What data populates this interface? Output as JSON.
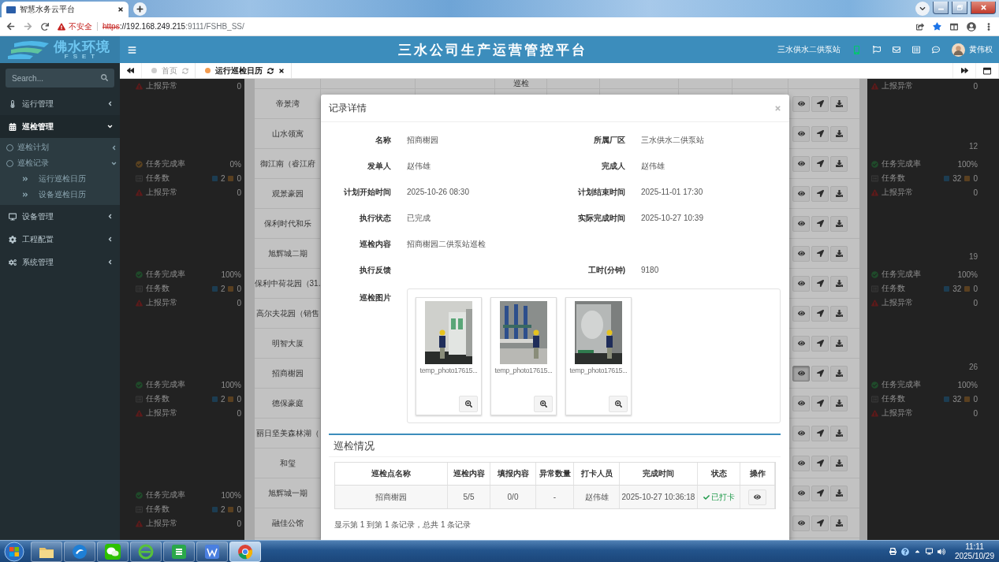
{
  "browser": {
    "tab_title": "智慧水务云平台",
    "warning": "不安全",
    "url": [
      {
        "kind": "scheme",
        "text": "https"
      },
      {
        "kind": "host",
        "text": "://192.168.249.215"
      },
      {
        "kind": "path",
        "text": ":9111/FSHB_SS/"
      }
    ]
  },
  "header": {
    "logo_name": "佛水环境",
    "logo_sub": "FSET",
    "title": "三水公司生产运营管控平台",
    "station": "三水供水二供泵站",
    "user": "黄伟权"
  },
  "sidebar": {
    "search_placeholder": "Search...",
    "items": [
      {
        "label": "运行管理",
        "selected": false,
        "expanded": false
      },
      {
        "label": "巡检管理",
        "selected": true,
        "expanded": true,
        "children": [
          {
            "label": "巡检计划",
            "expanded": false
          },
          {
            "label": "巡检记录",
            "expanded": true,
            "children": [
              {
                "label": "运行巡检日历"
              },
              {
                "label": "设备巡检日历"
              }
            ]
          }
        ]
      },
      {
        "label": "设备管理",
        "selected": false,
        "expanded": false
      },
      {
        "label": "工程配置",
        "selected": false,
        "expanded": false
      },
      {
        "label": "系统管理",
        "selected": false,
        "expanded": false
      }
    ]
  },
  "page_tabs": [
    {
      "label": "首页",
      "selected": false,
      "closable": false
    },
    {
      "label": "运行巡检日历",
      "selected": true,
      "closable": true
    }
  ],
  "calendar_left": {
    "top": [
      {
        "kind": "anomaly",
        "label": "上报异常",
        "value": "0"
      }
    ],
    "weeks": [
      {
        "stats": [
          {
            "kind": "rate",
            "label": "任务完成率",
            "value": "0%",
            "color": "#5a4220"
          },
          {
            "kind": "count",
            "label": "任务数",
            "done": "2",
            "pending": "0"
          },
          {
            "kind": "anomaly",
            "label": "上报异常",
            "value": "0"
          }
        ]
      },
      {
        "stats": [
          {
            "kind": "rate",
            "label": "任务完成率",
            "value": "100%",
            "color": "#1f4a2a"
          },
          {
            "kind": "count",
            "label": "任务数",
            "done": "2",
            "pending": "0"
          },
          {
            "kind": "anomaly",
            "label": "上报异常",
            "value": "0"
          }
        ]
      },
      {
        "stats": [
          {
            "kind": "rate",
            "label": "任务完成率",
            "value": "100%",
            "color": "#1f4a2a"
          },
          {
            "kind": "count",
            "label": "任务数",
            "done": "2",
            "pending": "0"
          },
          {
            "kind": "anomaly",
            "label": "上报异常",
            "value": "0"
          }
        ]
      },
      {
        "stats": [
          {
            "kind": "rate",
            "label": "任务完成率",
            "value": "100%",
            "color": "#1f4a2a"
          },
          {
            "kind": "count",
            "label": "任务数",
            "done": "2",
            "pending": "0"
          },
          {
            "kind": "anomaly",
            "label": "上报异常",
            "value": "0"
          }
        ]
      }
    ]
  },
  "calendar_right": {
    "top": [
      {
        "kind": "anomaly",
        "label": "上报异常",
        "value": "0"
      }
    ],
    "weeks": [
      {
        "day": "12",
        "stats": [
          {
            "kind": "rate",
            "label": "任务完成率",
            "value": "100%",
            "color": "#1f4a2a"
          },
          {
            "kind": "count",
            "label": "任务数",
            "done": "32",
            "pending": "0"
          },
          {
            "kind": "anomaly",
            "label": "上报异常",
            "value": "0"
          }
        ]
      },
      {
        "day": "19",
        "stats": [
          {
            "kind": "rate",
            "label": "任务完成率",
            "value": "100%",
            "color": "#1f4a2a"
          },
          {
            "kind": "count",
            "label": "任务数",
            "done": "32",
            "pending": "0"
          },
          {
            "kind": "anomaly",
            "label": "上报异常",
            "value": "0"
          }
        ]
      },
      {
        "day": "26",
        "stats": [
          {
            "kind": "rate",
            "label": "任务完成率",
            "value": "100%",
            "color": "#1f4a2a"
          },
          {
            "kind": "count",
            "label": "任务数",
            "done": "32",
            "pending": "0"
          },
          {
            "kind": "anomaly",
            "label": "上报异常",
            "value": "0"
          }
        ]
      }
    ]
  },
  "table": {
    "partial_row_text": "巡检",
    "rows": [
      {
        "name": "帝景湾",
        "selected": false
      },
      {
        "name": "山水领寓",
        "selected": false
      },
      {
        "name": "御江南（睿江府",
        "selected": false
      },
      {
        "name": "观景豪园",
        "selected": false
      },
      {
        "name": "保利时代和乐",
        "selected": false
      },
      {
        "name": "旭辉城二期",
        "selected": false
      },
      {
        "name": "保利中荷花园（31.",
        "selected": false
      },
      {
        "name": "高尔夫花园（销售",
        "selected": false
      },
      {
        "name": "明智大厦",
        "selected": false
      },
      {
        "name": "招商榭园",
        "selected": true
      },
      {
        "name": "德保豪庭",
        "selected": false
      },
      {
        "name": "丽日坚美森林湖（",
        "selected": false
      },
      {
        "name": "和玺",
        "selected": false
      },
      {
        "name": "旭辉城一期",
        "selected": false
      },
      {
        "name": "融佳公馆",
        "selected": false
      }
    ]
  },
  "modal": {
    "title": "记录详情",
    "rows": [
      {
        "fields": [
          {
            "label": "名称",
            "value": "招商榭园"
          },
          {
            "label": "所属厂区",
            "value": "三水供水二供泵站"
          }
        ]
      },
      {
        "fields": [
          {
            "label": "发单人",
            "value": "赵伟雄"
          },
          {
            "label": "完成人",
            "value": "赵伟雄"
          }
        ]
      },
      {
        "fields": [
          {
            "label": "计划开始时间",
            "value": "2025-10-26 08:30"
          },
          {
            "label": "计划结束时间",
            "value": "2025-11-01 17:30"
          }
        ]
      },
      {
        "fields": [
          {
            "label": "执行状态",
            "value": "已完成"
          },
          {
            "label": "实际完成时间",
            "value": "2025-10-27 10:39"
          }
        ]
      },
      {
        "fields": [
          {
            "label": "巡检内容",
            "value": "招商榭园二供泵站巡检"
          }
        ]
      },
      {
        "fields": [
          {
            "label": "执行反馈"
          },
          {
            "label": "工时(分钟)",
            "value": "9180"
          }
        ]
      }
    ],
    "photos": {
      "label": "巡检图片",
      "items": [
        {
          "filename": "temp_photo17615..."
        },
        {
          "filename": "temp_photo17615..."
        },
        {
          "filename": "temp_photo17615..."
        }
      ]
    },
    "inspection": {
      "title": "巡检情况",
      "columns": [
        "巡检点名称",
        "巡检内容",
        "填报内容",
        "异常数量",
        "打卡人员",
        "完成时间",
        "状态",
        "操作"
      ],
      "rows": [
        {
          "cells": [
            "招商榭园",
            "5/5",
            "0/0",
            "-",
            "赵伟雄",
            "2025-10-27 10:36:18"
          ],
          "status": "已打卡",
          "checked_in": true
        }
      ],
      "footer": "显示第 1 到第 1 条记录，总共 1 条记录"
    }
  },
  "taskbar": {
    "apps": [
      {
        "kind": "folder",
        "active": false
      },
      {
        "kind": "blue-circle",
        "active": false
      },
      {
        "kind": "chat",
        "active": false
      },
      {
        "kind": "globe-e",
        "active": false
      },
      {
        "kind": "sheet",
        "active": false
      },
      {
        "kind": "writer",
        "active": false
      },
      {
        "kind": "chrome",
        "active": true
      }
    ],
    "time": "11:11",
    "date": "2025/10/29"
  }
}
